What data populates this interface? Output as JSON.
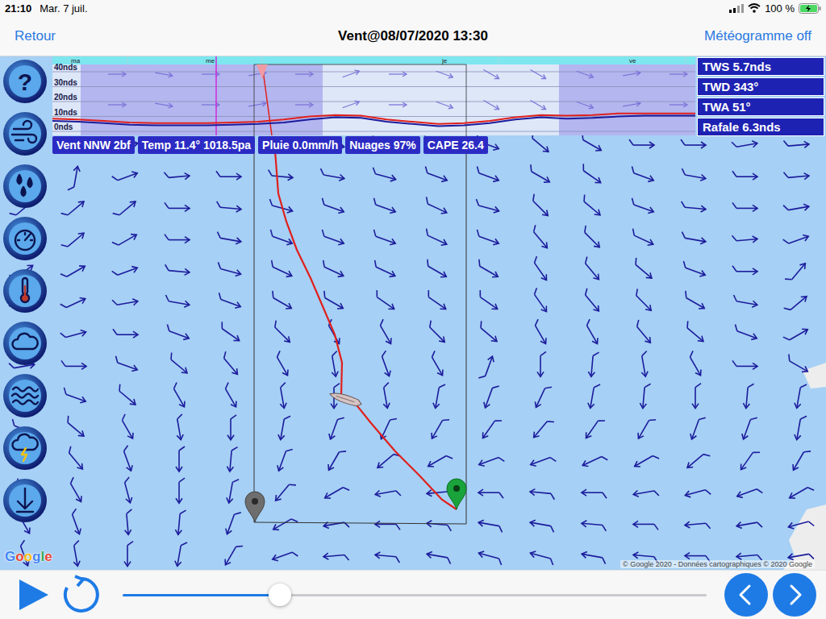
{
  "status_bar": {
    "time": "21:10",
    "date": "Mar. 7 juil.",
    "battery": "100 %",
    "battery_level": 1.0,
    "charging": true
  },
  "nav": {
    "back": "Retour",
    "title": "Vent@08/07/2020 13:30",
    "right": "Météogramme off"
  },
  "meteogram": {
    "axis": [
      "40nds",
      "30nds",
      "20nds",
      "10nds",
      "0nds"
    ],
    "days": [
      "ma",
      "me",
      "je",
      "ve"
    ],
    "wind": [
      7,
      6.5,
      5.5,
      4.5,
      4,
      4,
      4,
      4.5,
      5,
      6,
      8,
      9.5,
      9,
      6.5,
      5,
      3.5,
      4,
      5.5,
      8,
      9.5,
      8.5,
      9,
      10,
      10.5,
      10.5,
      10.5
    ],
    "gust": [
      8.5,
      8,
      7,
      6,
      5.5,
      5.5,
      5.5,
      6,
      6.5,
      8,
      10,
      11,
      10.5,
      8,
      6.5,
      5,
      5.5,
      7,
      9.5,
      11,
      10.5,
      11,
      12,
      12,
      12,
      12
    ],
    "arrow_directions": [
      0,
      10,
      0,
      -10,
      0,
      -20,
      0,
      20,
      30,
      30,
      20,
      -10,
      0
    ]
  },
  "readout": [
    "TWS 5.7nds",
    "TWD 343°",
    "TWA 51°",
    "Rafale 6.3nds"
  ],
  "chips": [
    "Vent NNW 2bf",
    "Temp 11.4° 1018.5pa",
    "Pluie 0.0mm/h",
    "Nuages 97%",
    "CAPE 26.4"
  ],
  "toolbar": [
    {
      "kind": "help",
      "glyph": "?"
    },
    {
      "kind": "wind"
    },
    {
      "kind": "rain"
    },
    {
      "kind": "gauge"
    },
    {
      "kind": "temperature"
    },
    {
      "kind": "cloud"
    },
    {
      "kind": "waves"
    },
    {
      "kind": "storm"
    },
    {
      "kind": "download"
    }
  ],
  "wind_field": [
    [
      -20,
      -20,
      -10,
      0,
      10,
      10,
      10,
      15,
      15,
      20,
      40,
      30,
      0,
      0,
      -10,
      -5
    ],
    [
      -30,
      -80,
      -20,
      -5,
      0,
      5,
      10,
      15,
      20,
      20,
      30,
      35,
      20,
      10,
      0,
      -5
    ],
    [
      -40,
      -40,
      -40,
      0,
      5,
      15,
      20,
      20,
      25,
      15,
      45,
      40,
      20,
      5,
      0,
      -10
    ],
    [
      -40,
      -40,
      -30,
      0,
      10,
      20,
      20,
      20,
      25,
      20,
      50,
      45,
      25,
      10,
      -5,
      -20
    ],
    [
      -35,
      -30,
      -20,
      5,
      15,
      25,
      25,
      25,
      30,
      30,
      55,
      50,
      40,
      20,
      0,
      -50
    ],
    [
      -30,
      -25,
      -10,
      10,
      20,
      30,
      30,
      35,
      35,
      35,
      55,
      50,
      45,
      30,
      10,
      -40
    ],
    [
      -20,
      -15,
      0,
      20,
      35,
      45,
      60,
      60,
      45,
      40,
      60,
      60,
      50,
      40,
      20,
      -30
    ],
    [
      -10,
      0,
      20,
      40,
      50,
      60,
      80,
      70,
      60,
      -70,
      90,
      95,
      80,
      60,
      0,
      30
    ],
    [
      10,
      20,
      40,
      60,
      60,
      80,
      90,
      80,
      100,
      110,
      115,
      100,
      95,
      90,
      95,
      100
    ],
    [
      20,
      40,
      60,
      80,
      90,
      100,
      110,
      115,
      120,
      125,
      130,
      125,
      120,
      110,
      110,
      100
    ],
    [
      30,
      50,
      70,
      90,
      95,
      110,
      120,
      140,
      150,
      160,
      160,
      155,
      150,
      140,
      125,
      120
    ],
    [
      45,
      60,
      75,
      90,
      100,
      130,
      150,
      170,
      175,
      180,
      185,
      180,
      170,
      165,
      160,
      150
    ],
    [
      60,
      70,
      85,
      95,
      110,
      150,
      170,
      180,
      185,
      190,
      190,
      185,
      180,
      175,
      170,
      165
    ],
    [
      70,
      80,
      90,
      100,
      120,
      160,
      175,
      185,
      190,
      195,
      195,
      190,
      185,
      180,
      175,
      170
    ]
  ],
  "map": {
    "logo": "Google",
    "attribution": "© Google 2020 - Données cartographiques © 2020 Google"
  },
  "playback": {
    "playing": false,
    "level": 0.27
  }
}
